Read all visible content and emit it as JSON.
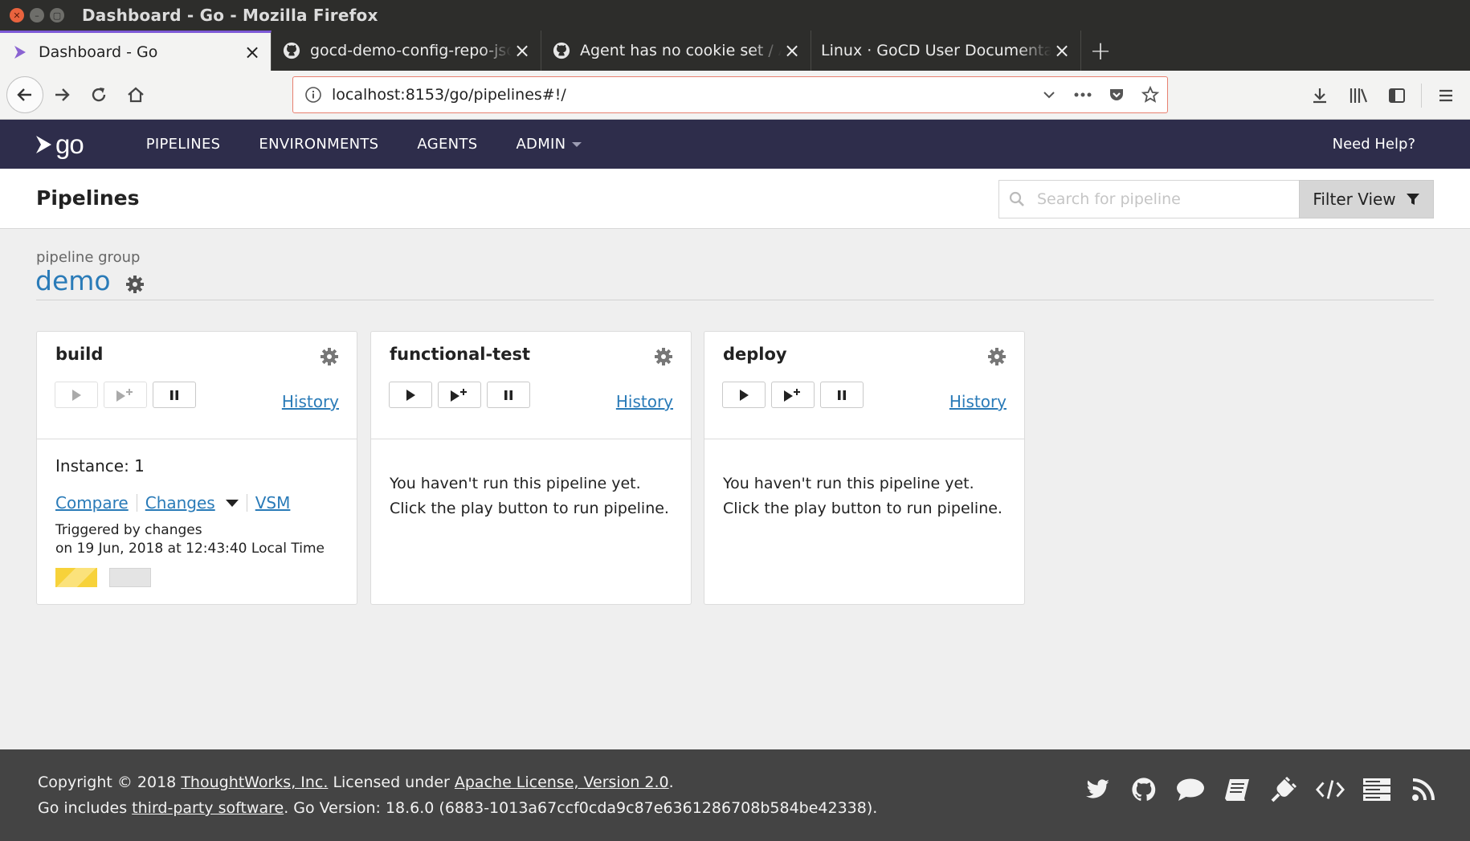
{
  "window": {
    "title": "Dashboard - Go - Mozilla Firefox"
  },
  "tabs": [
    {
      "label": "Dashboard - Go",
      "icon": "gocd-logo-icon"
    },
    {
      "label": "gocd-demo-config-repo-jso",
      "icon": "github-icon"
    },
    {
      "label": "Agent has no cookie set / A",
      "icon": "github-icon"
    },
    {
      "label": "Linux · GoCD User Documentati",
      "icon": "none"
    }
  ],
  "urlbar": {
    "url": "localhost:8153/go/pipelines#!/"
  },
  "gocd": {
    "logo": "go",
    "nav": [
      "PIPELINES",
      "ENVIRONMENTS",
      "AGENTS",
      "ADMIN"
    ],
    "help": "Need Help?"
  },
  "page": {
    "title": "Pipelines",
    "search_placeholder": "Search for pipeline",
    "filter_label": "Filter View"
  },
  "group": {
    "label": "pipeline group",
    "name": "demo"
  },
  "pipelines": [
    {
      "name": "build",
      "history": "History",
      "instance": "Instance: 1",
      "compare": "Compare",
      "changes": "Changes",
      "vsm": "VSM",
      "triggered_by": "Triggered by changes",
      "triggered_on": "on 19 Jun, 2018 at 12:43:40 Local Time",
      "stages": [
        "building",
        "idle"
      ]
    },
    {
      "name": "functional-test",
      "history": "History",
      "message": "You haven't run this pipeline yet. Click the play button to run pipeline."
    },
    {
      "name": "deploy",
      "history": "History",
      "message": "You haven't run this pipeline yet. Click the play button to run pipeline."
    }
  ],
  "footer": {
    "copyright_prefix": "Copyright © 2018 ",
    "thoughtworks": "ThoughtWorks, Inc.",
    "licensed_under": " Licensed under ",
    "license": "Apache License, Version 2.0",
    "period": ".",
    "go_includes": "Go includes ",
    "third_party": "third-party software",
    "version": ". Go Version: 18.6.0 (6883-1013a67ccf0cda9c87e6361286708b584be42338).",
    "icons": [
      "twitter-icon",
      "github-icon",
      "chat-icon",
      "docs-icon",
      "plugin-icon",
      "api-icon",
      "server-icon",
      "rss-icon"
    ]
  },
  "colors": {
    "header_bg": "#2e2d4b",
    "link": "#2a7bb8",
    "footer_bg": "#444444",
    "building": "#f7d23a"
  }
}
